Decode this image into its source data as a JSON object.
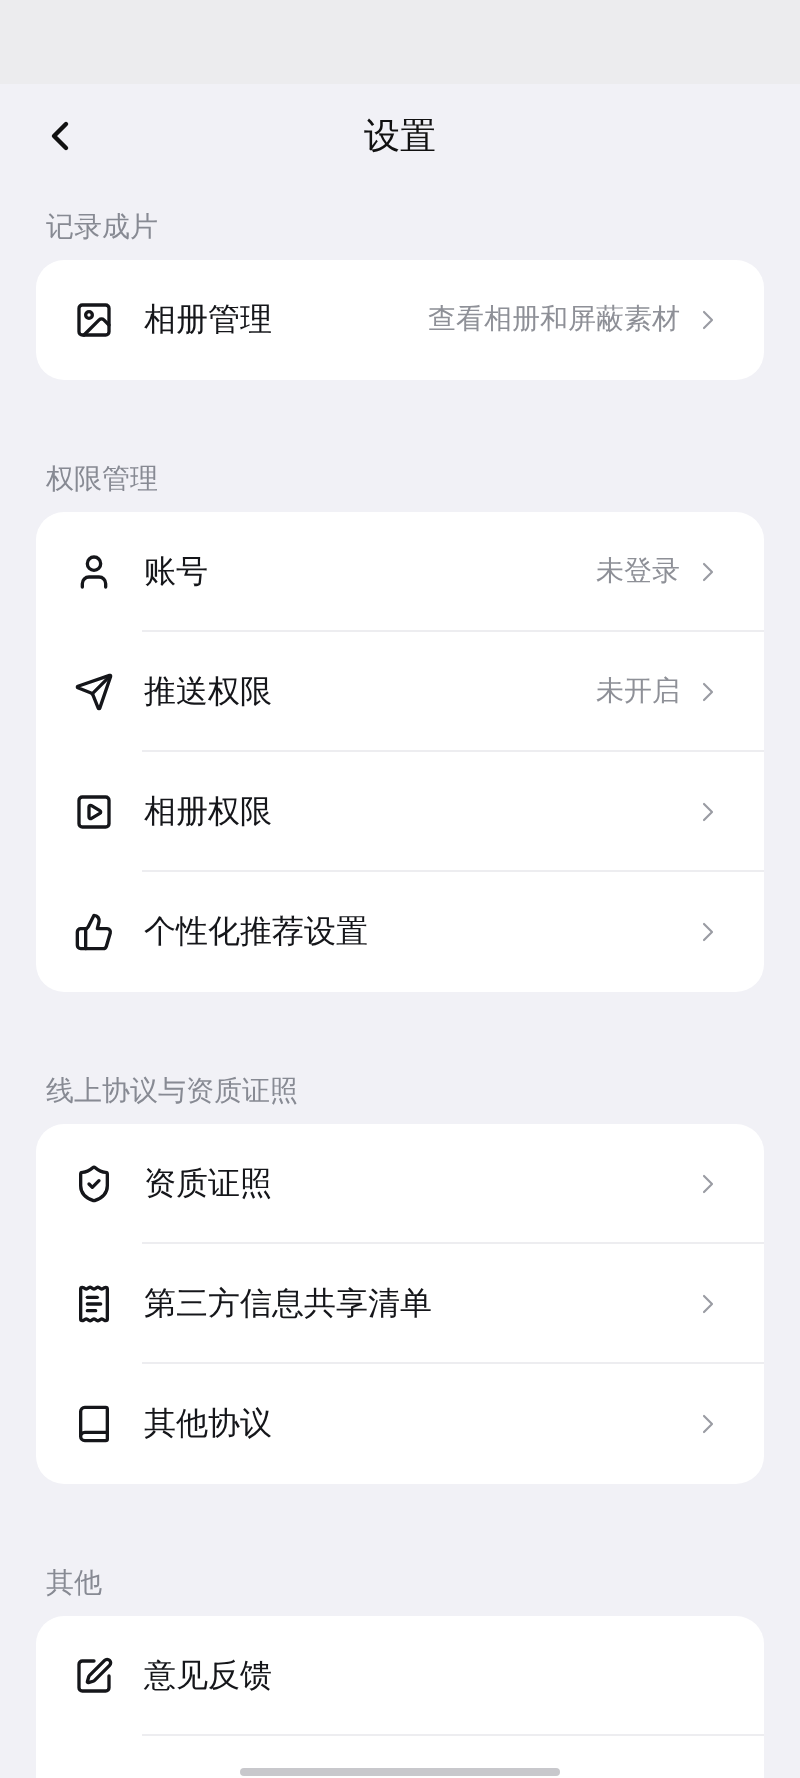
{
  "header": {
    "title": "设置"
  },
  "sections": [
    {
      "title": "记录成片",
      "items": [
        {
          "label": "相册管理",
          "value": "查看相册和屏蔽素材",
          "chevron": true
        }
      ]
    },
    {
      "title": "权限管理",
      "items": [
        {
          "label": "账号",
          "value": "未登录",
          "chevron": true
        },
        {
          "label": "推送权限",
          "value": "未开启",
          "chevron": true
        },
        {
          "label": "相册权限",
          "chevron": true
        },
        {
          "label": "个性化推荐设置",
          "chevron": true
        }
      ]
    },
    {
      "title": "线上协议与资质证照",
      "items": [
        {
          "label": "资质证照",
          "chevron": true
        },
        {
          "label": "第三方信息共享清单",
          "chevron": true
        },
        {
          "label": "其他协议",
          "chevron": true
        }
      ]
    },
    {
      "title": "其他",
      "items": [
        {
          "label": "意见反馈",
          "chevron": false
        }
      ]
    }
  ]
}
